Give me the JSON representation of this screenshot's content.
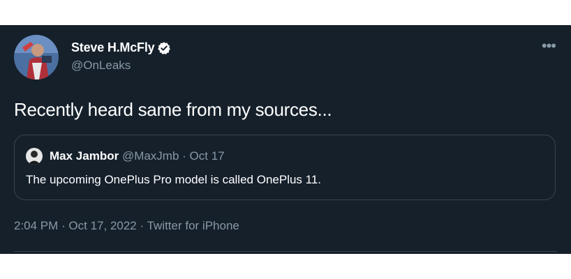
{
  "author": {
    "display_name": "Steve H.McFly",
    "handle": "@OnLeaks",
    "verified": true,
    "avatar_icon": "avatar-photo"
  },
  "menu": {
    "more_icon": "more-horizontal-icon",
    "more_label": "•••"
  },
  "tweet": {
    "text": "Recently heard same from my sources..."
  },
  "quoted_tweet": {
    "display_name": "Max Jambor",
    "meta": "@MaxJmb · Oct 17",
    "text": "The upcoming OnePlus Pro model is called OnePlus 11."
  },
  "timestamp": {
    "time": "2:04 PM",
    "separator_1": " · ",
    "date": "Oct 17, 2022",
    "separator_2": " · ",
    "source": "Twitter for iPhone"
  },
  "colors": {
    "background": "#15202b",
    "text_primary": "#ffffff",
    "text_secondary": "#8899a6",
    "border": "#38444d",
    "verified_badge": "#ffffff"
  }
}
